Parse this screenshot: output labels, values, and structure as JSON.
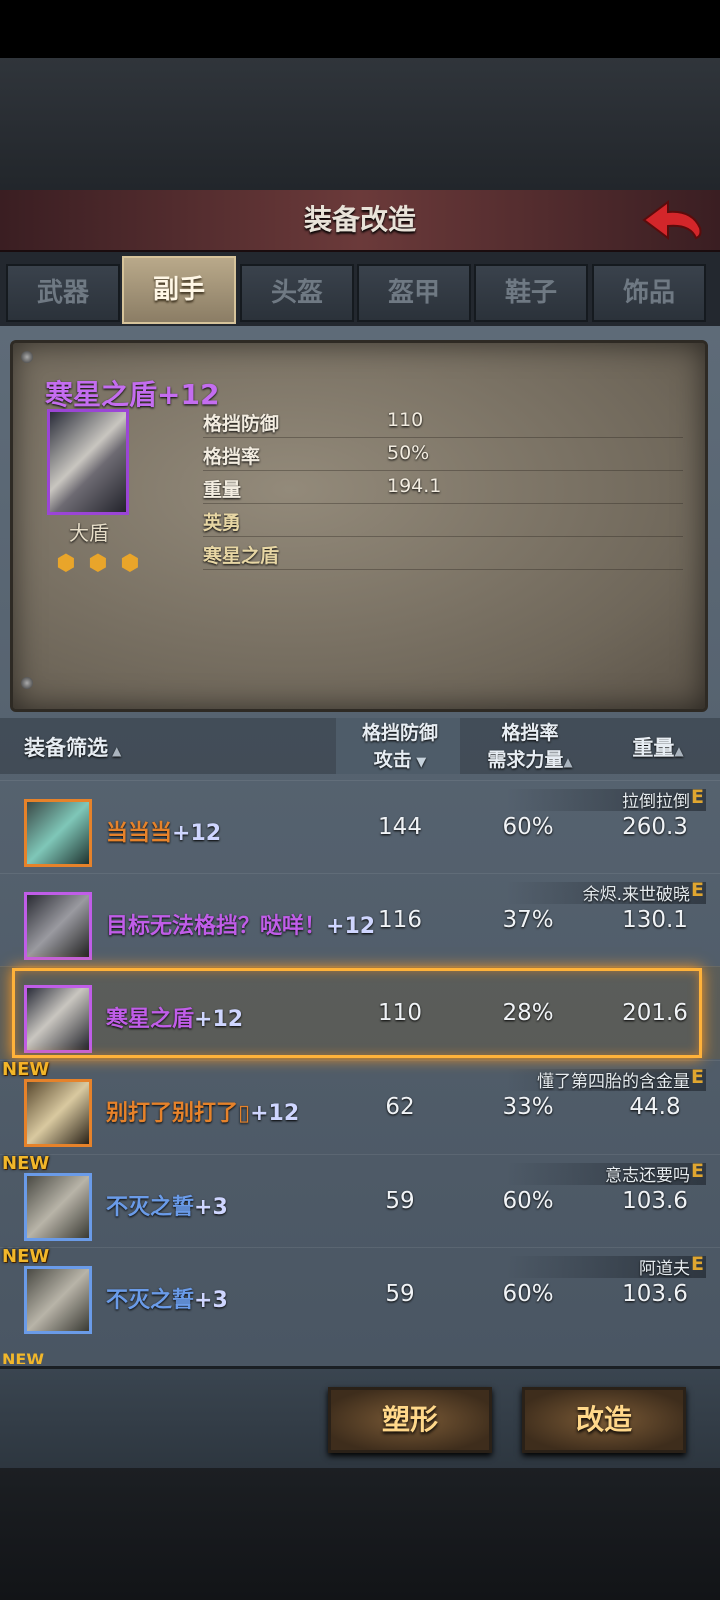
{
  "title": "装备改造",
  "tabs": [
    "武器",
    "副手",
    "头盔",
    "盔甲",
    "鞋子",
    "饰品"
  ],
  "active_tab": "副手",
  "selected_item": {
    "name": "寒星之盾+12",
    "type": "大盾",
    "stats": [
      {
        "label": "格挡防御",
        "value": "110"
      },
      {
        "label": "格挡率",
        "value": "50%"
      },
      {
        "label": "重量",
        "value": "194.1"
      },
      {
        "label": "英勇",
        "value": ""
      },
      {
        "label": "寒星之盾",
        "value": ""
      }
    ]
  },
  "list_header": {
    "filter": "装备筛选",
    "col1_top": "格挡防御",
    "col1_bottom": "攻击",
    "col2_top": "格挡率",
    "col2_bottom": "需求力量",
    "col3": "重量"
  },
  "rows": [
    {
      "tag": "拉倒拉倒",
      "grade": "E",
      "name": "当当当",
      "plus": "+12",
      "v1": "144",
      "v2": "60%",
      "v3": "260.3",
      "new": "",
      "color": "#e6822a"
    },
    {
      "tag": "余烬.来世破晓",
      "grade": "E",
      "name": "目标无法格挡？哒咩！",
      "plus": "+12",
      "v1": "116",
      "v2": "37%",
      "v3": "130.1",
      "new": "",
      "color": "#c05de8"
    },
    {
      "tag": "",
      "grade": "",
      "name": "寒星之盾",
      "plus": "+12",
      "v1": "110",
      "v2": "28%",
      "v3": "201.6",
      "new": "",
      "color": "#c05de8"
    },
    {
      "tag": "懂了第四胎的含金量",
      "grade": "E",
      "name": "别打了别打了▯",
      "plus": "+12",
      "v1": "62",
      "v2": "33%",
      "v3": "44.8",
      "new": "NEW",
      "color": "#e6822a"
    },
    {
      "tag": "意志还要吗",
      "grade": "E",
      "name": "不灭之誓",
      "plus": "+3",
      "v1": "59",
      "v2": "60%",
      "v3": "103.6",
      "new": "NEW",
      "color": "#6a9be8"
    },
    {
      "tag": "阿道夫",
      "grade": "E",
      "name": "不灭之誓",
      "plus": "+3",
      "v1": "59",
      "v2": "60%",
      "v3": "103.6",
      "new": "NEW",
      "color": "#6a9be8"
    }
  ],
  "row_partial_new": "NEW",
  "buttons": {
    "reshape": "塑形",
    "modify": "改造"
  }
}
